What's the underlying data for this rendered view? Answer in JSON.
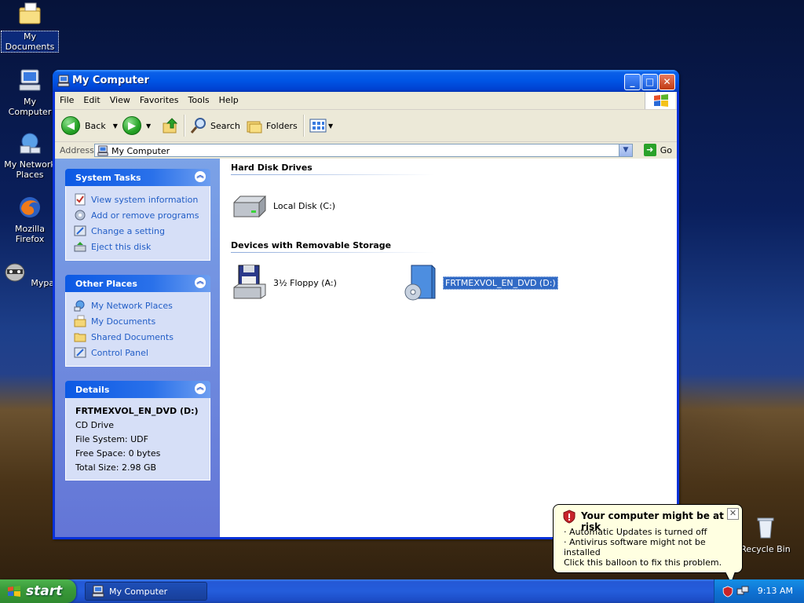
{
  "desktop": {
    "icons": [
      {
        "label": "My Documents",
        "icon": "folder-documents-icon"
      },
      {
        "label": "My Computer",
        "icon": "computer-icon"
      },
      {
        "label": "My Network Places",
        "icon": "network-icon"
      },
      {
        "label": "Mozilla Firefox",
        "icon": "firefox-icon"
      },
      {
        "label": "Mypal",
        "icon": "mypal-icon"
      },
      {
        "label": "Recycle Bin",
        "icon": "recycle-bin-icon"
      }
    ]
  },
  "window": {
    "title": "My Computer",
    "menu": [
      "File",
      "Edit",
      "View",
      "Favorites",
      "Tools",
      "Help"
    ],
    "toolbar": {
      "back": "Back",
      "search": "Search",
      "folders": "Folders"
    },
    "address": {
      "label": "Address",
      "value": "My Computer",
      "go": "Go"
    }
  },
  "sidebar": {
    "system_tasks": {
      "title": "System Tasks",
      "items": [
        "View system information",
        "Add or remove programs",
        "Change a setting",
        "Eject this disk"
      ]
    },
    "other_places": {
      "title": "Other Places",
      "items": [
        "My Network Places",
        "My Documents",
        "Shared Documents",
        "Control Panel"
      ]
    },
    "details": {
      "title": "Details",
      "name": "FRTMEXVOL_EN_DVD (D:)",
      "type": "CD Drive",
      "file_system": "File System: UDF",
      "free_space": "Free Space: 0 bytes",
      "total_size": "Total Size: 2.98 GB"
    }
  },
  "files": {
    "groups": [
      {
        "title": "Hard Disk Drives",
        "items": [
          {
            "label": "Local Disk (C:)"
          }
        ]
      },
      {
        "title": "Devices with Removable Storage",
        "items": [
          {
            "label": "3½ Floppy (A:)"
          },
          {
            "label": "FRTMEXVOL_EN_DVD (D:)",
            "selected": true
          }
        ]
      }
    ]
  },
  "taskbar": {
    "start": "start",
    "task": "My Computer",
    "clock": "9:13 AM"
  },
  "balloon": {
    "title": "Your computer might be at risk",
    "line1": "· Automatic Updates is turned off",
    "line2": "· Antivirus software might not be installed",
    "line3": "Click this balloon to fix this problem."
  },
  "colors": {
    "link": "#215dc6",
    "titlebar": "#0055e5",
    "selection": "#316ac5",
    "taskbar": "#245ddb",
    "start": "#3a9a3a"
  }
}
